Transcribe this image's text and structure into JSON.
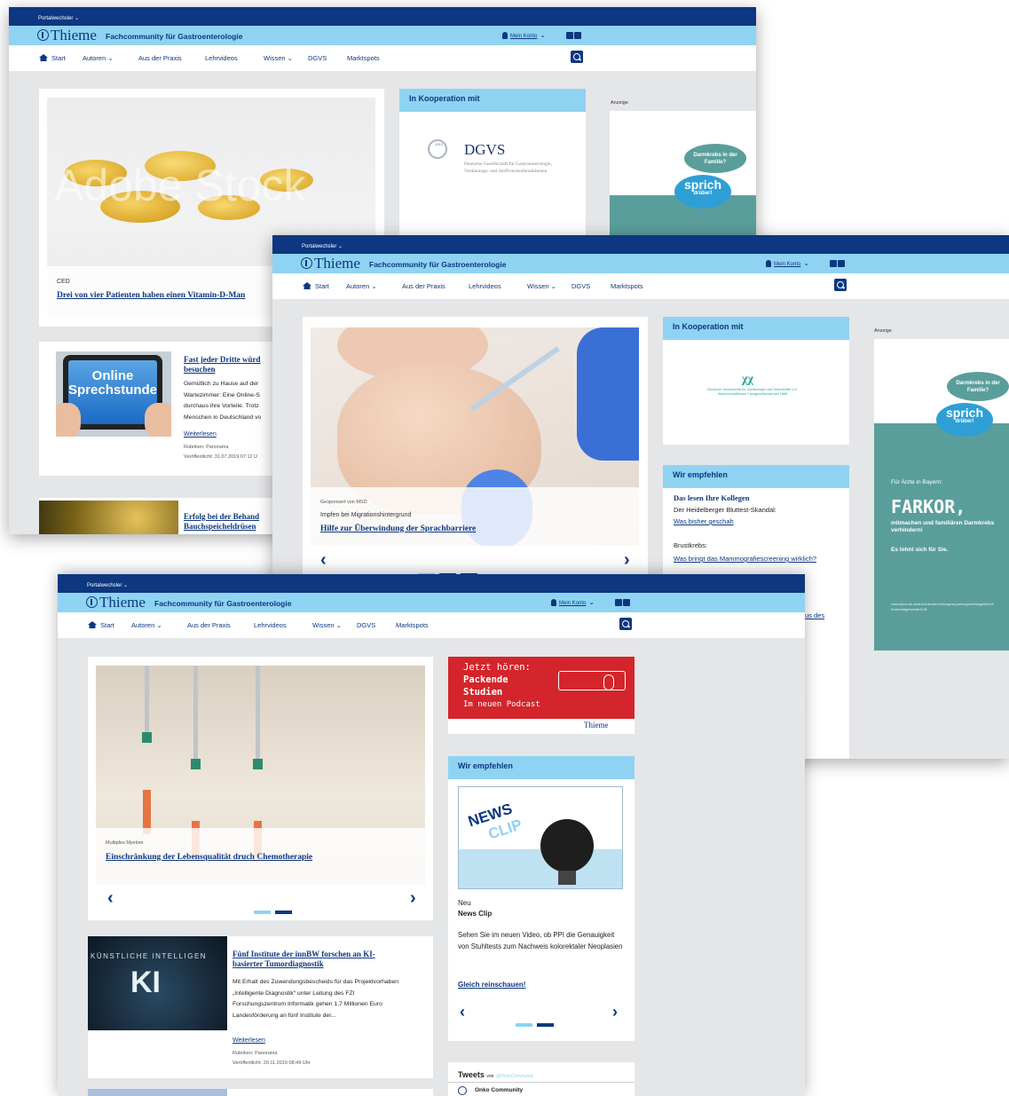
{
  "site": {
    "portal_switcher": "Portalwechsler ⌄",
    "logo": "Thieme",
    "subtitle": "Fachcommunity für Gastroenterologie",
    "account": "Mein Konto",
    "nav": [
      "Start",
      "Autoren ⌄",
      "Aus der Praxis",
      "Lehrvideos",
      "Wissen ⌄",
      "DGVS",
      "Marktspots"
    ]
  },
  "s1": {
    "slide": {
      "watermark": "Adobe Stock",
      "kicker": "CED",
      "title": "Drei von vier Patienten haben einen Vitamin-D-Man"
    },
    "coop": {
      "header": "In Kooperation mit",
      "logo_title": "DGVS",
      "logo_year": "1913",
      "logo_desc": "Deutsche Gesellschaft für Gastroenterologie, Verdauungs- und Stoffwechselkrankheiten"
    },
    "ad": {
      "label": "Anzeige",
      "bubble1": "Darmkrebs in der Familie?",
      "bubble2": "sprich",
      "bubble2b": "drüber!"
    },
    "article1": {
      "image_text1": "Online",
      "image_text2": "Sprechstunde",
      "title": "Fast jeder Dritte würd besuchen",
      "body": "Gemütlich zu Hause auf der Wartezimmer: Eine Online-S durchaus ihre Vorteile. Trotz Menschen in Deutschland vo",
      "more": "Weiterlesen",
      "rubric": "Rubriken: Panorama",
      "date": "Veröffentlicht: 31.07.2019 07:12 U"
    },
    "article2": {
      "title": "Erfolg bei der Behand Bauchspeicheldrüsen"
    }
  },
  "s2": {
    "slide": {
      "sponsor": "Gesponsert von MSD",
      "kicker": "Impfen bei Migrationshintergrund",
      "title": "Hilfe zur Überwindung der Sprachbarriere"
    },
    "coop": {
      "header": "In Kooperation mit",
      "logo_desc": "Deutsche Gesellschaft für Gynäkologie und Geburtshilfe e.V. Wissenschaftlichen Fachgesellschaft seit 1885"
    },
    "wir": {
      "header": "Wir empfehlen",
      "subhead": "Das lesen Ihre Kollegen",
      "item1": "Der Heidelberger Bluttest-Skandal:",
      "link1": "Was bisher geschah",
      "item2": "Brustkrebs:",
      "link2": "Was bringt das Mammografiescreening wirklich?",
      "link3_tail": "us des",
      "link4_tail": "f"
    },
    "ad": {
      "label": "Anzeige",
      "bubble1": "Darmkrebs in der Familie?",
      "bubble2": "sprich",
      "bubble2b": "drüber!",
      "for": "Für Ärzte in Bayern:",
      "brand": "FARKOR,",
      "claim": "mitmachen und familiären Darmkrebs verhindern!",
      "tag": "Es lohnt sich für Sie.",
      "url": "www.farkor.de www.kvb.de/abrechnung/verguetungsvertraege/farkor/ Kostenträgerschaft KVB"
    }
  },
  "s3": {
    "slide": {
      "kicker": "Multiples Myelom",
      "title": "Einschränkung der Lebensqualität druch Chemotherapie"
    },
    "podcast": {
      "line1": "Jetzt hören:",
      "line2": "Packende",
      "line3": "Studien",
      "line4": "Im neuen Podcast",
      "logo": "Thieme"
    },
    "wir": {
      "header": "Wir empfehlen",
      "clip1": "NEWS",
      "clip2": "CLIP",
      "label": "Neu",
      "title": "News Clip",
      "body": "Sehen Sie im neuen Video, ob PPI die Genauigkeit von Stuhltests zum Nachweis kolorektaler Neoplasien",
      "cta": "Gleich reinschauen!"
    },
    "article1": {
      "image_text1": "KÜNSTLICHE INTELLIGEN",
      "image_text2": "KI",
      "title": "Fünf Institute der innBW forschen an KI-basierter Tumordiagnostik",
      "body": "Mit Erhalt des Zuwendungsbescheids für das Projektvorhaben „Intelligente Diagnostik“ unter Leitung des FZI Forschungszentrum Informatik gehen 1,7 Millionen Euro Landesförderung an fünf Institute der...",
      "more": "Weiterlesen",
      "rubric": "Rubriken: Panorama",
      "date": "Veröffentlicht: 20.11.2019 08:49 Uhr"
    },
    "tweets": {
      "title": "Tweets",
      "by": "von",
      "handle": "@OnkoCommunity",
      "user": "Onko Community"
    }
  },
  "colors": {
    "navy": "#0d3780",
    "lightblue": "#8fd3f2",
    "teal": "#5a9e9c",
    "red": "#d3252b"
  }
}
